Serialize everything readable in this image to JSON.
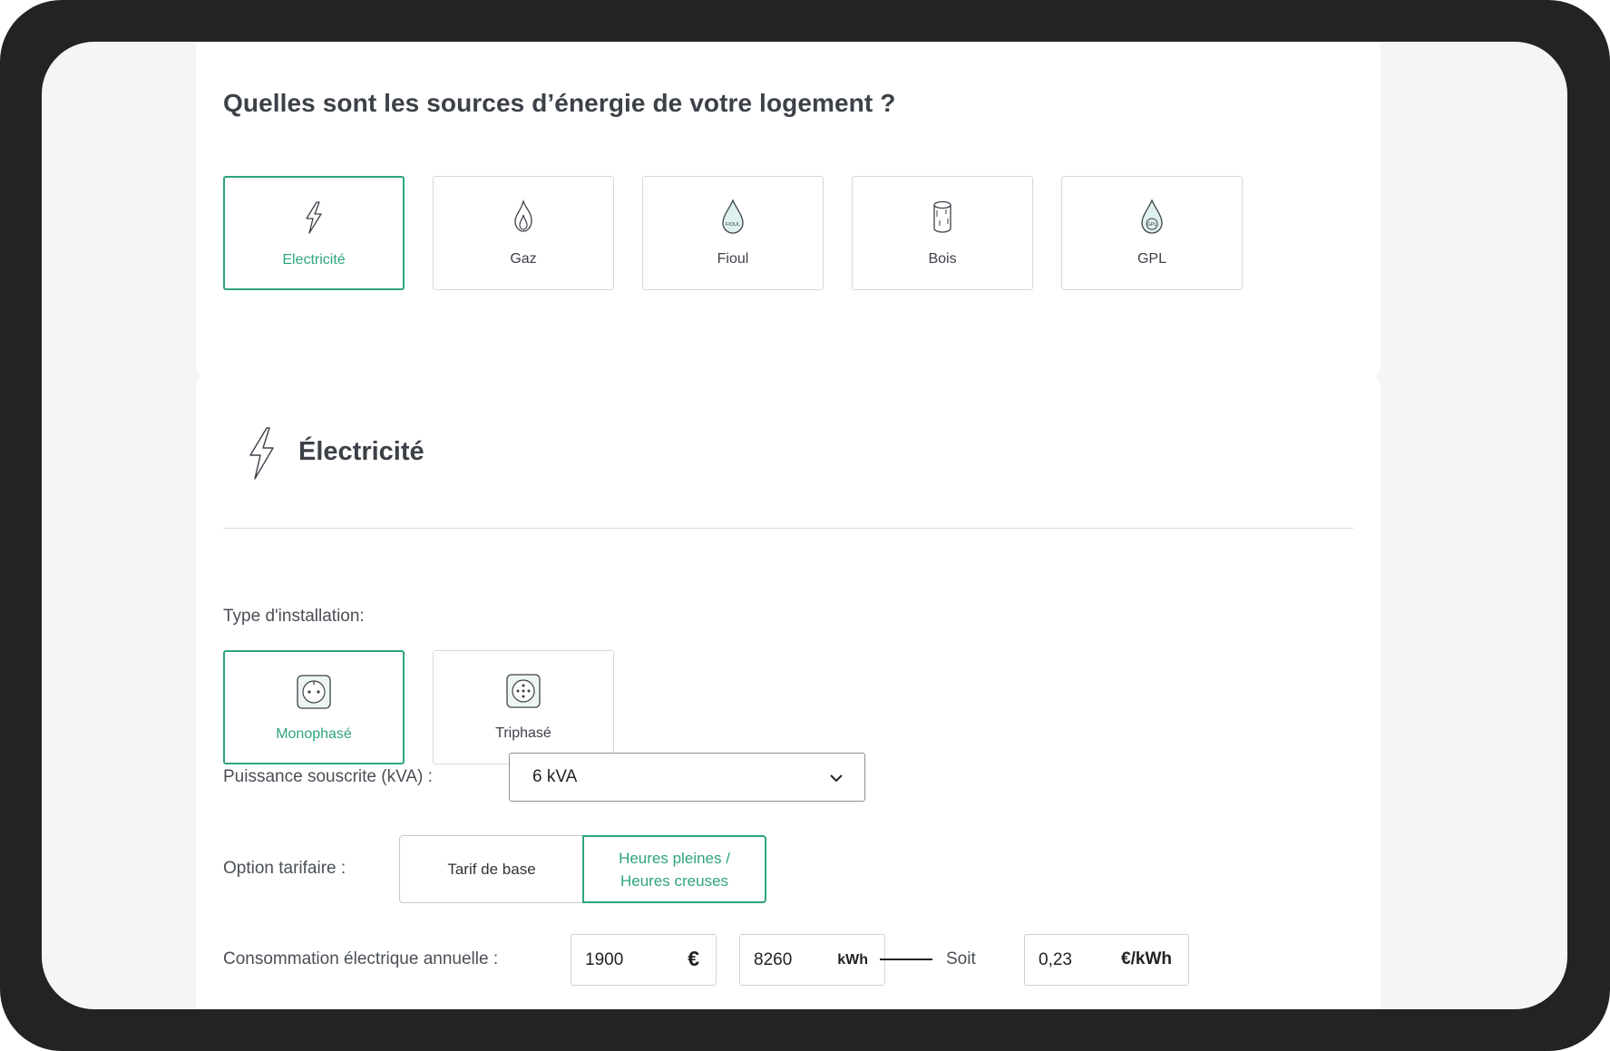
{
  "sources": {
    "title": "Quelles sont les sources d’énergie de votre logement ?",
    "options": [
      {
        "label": "Electricité",
        "icon": "lightning-icon",
        "selected": true
      },
      {
        "label": "Gaz",
        "icon": "flame-icon",
        "selected": false
      },
      {
        "label": "Fioul",
        "icon": "fuel-drop-icon",
        "icon_text": "FIOUL",
        "selected": false
      },
      {
        "label": "Bois",
        "icon": "log-icon",
        "selected": false
      },
      {
        "label": "GPL",
        "icon": "gpl-drop-icon",
        "icon_text": "GPL",
        "selected": false
      }
    ]
  },
  "electricity": {
    "title": "Électricité",
    "installation": {
      "label": "Type d'installation:",
      "options": [
        {
          "label": "Monophasé",
          "icon": "single-phase-socket-icon",
          "selected": true
        },
        {
          "label": "Triphasé",
          "icon": "three-phase-socket-icon",
          "selected": false
        }
      ]
    },
    "power": {
      "label": "Puissance souscrite (kVA) :",
      "value": "6 kVA"
    },
    "tariff": {
      "label": "Option tarifaire :",
      "options": [
        {
          "label": "Tarif de base",
          "selected": false
        },
        {
          "label": "Heures pleines / Heures creuses",
          "line1": "Heures pleines /",
          "line2": "Heures creuses",
          "selected": true
        }
      ]
    },
    "consumption": {
      "label": "Consommation électrique annuelle :",
      "euros": {
        "value": "1900",
        "unit": "€"
      },
      "kwh": {
        "value": "8260",
        "unit": "kWh"
      },
      "soit": "Soit",
      "price": {
        "value": "0,23",
        "unit": "€/kWh"
      }
    }
  },
  "colors": {
    "accent": "#2ea57a",
    "text": "#3c4148",
    "frame": "#232325",
    "screen_bg": "#f4f5f5"
  }
}
